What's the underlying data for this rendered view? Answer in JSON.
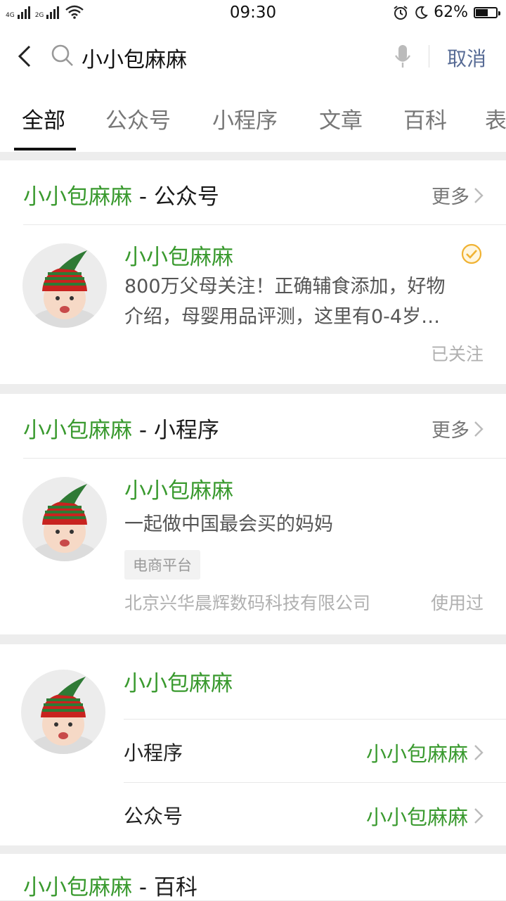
{
  "status_bar": {
    "net1": "4G",
    "net2": "2G",
    "time": "09:30",
    "battery": "62%",
    "battery_level": 0.62
  },
  "search": {
    "query": "小小包麻麻",
    "cancel_label": "取消"
  },
  "tabs": [
    "全部",
    "公众号",
    "小程序",
    "文章",
    "百科",
    "表"
  ],
  "official_account_section": {
    "title_name": "小小包麻麻",
    "title_suffix": " - 公众号",
    "more_label": "更多",
    "item": {
      "name": "小小包麻麻",
      "desc_line1": "800万父母关注！正确辅食添加，好物",
      "desc_line2": "介绍，母婴用品评测，这里有0-4岁…",
      "status": "已关注"
    }
  },
  "mini_program_section": {
    "title_name": "小小包麻麻",
    "title_suffix": " - 小程序",
    "more_label": "更多",
    "item": {
      "name": "小小包麻麻",
      "desc": "一起做中国最会买的妈妈",
      "tag": "电商平台",
      "company": "北京兴华晨辉数码科技有限公司",
      "status": "使用过"
    }
  },
  "brand_card": {
    "name": "小小包麻麻",
    "rows": [
      {
        "label": "小程序",
        "value": "小小包麻麻"
      },
      {
        "label": "公众号",
        "value": "小小包麻麻"
      }
    ]
  },
  "baike_section": {
    "title_name": "小小包麻麻",
    "title_suffix": " - 百科"
  },
  "colors": {
    "accent_green": "#3a9a2f",
    "link_blue": "#576b95",
    "verified_badge": "#f0b232"
  }
}
